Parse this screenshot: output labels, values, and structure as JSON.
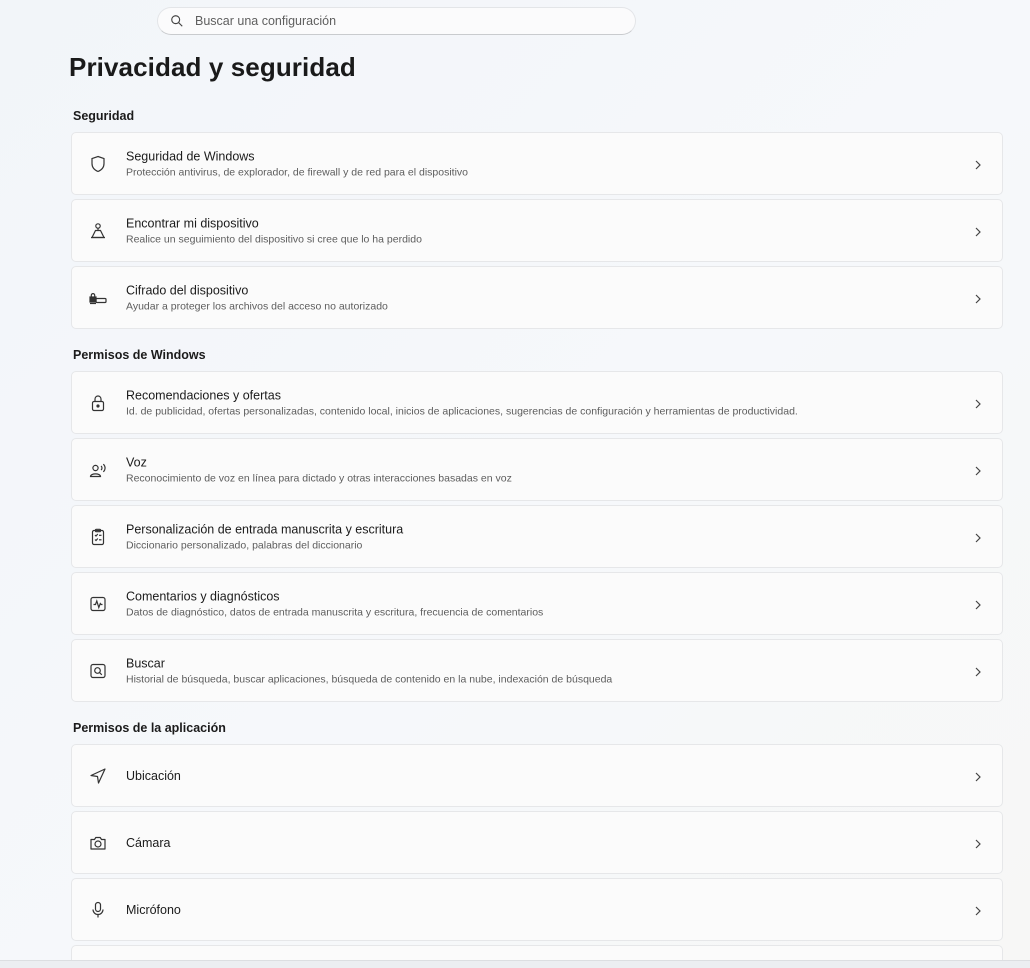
{
  "search": {
    "placeholder": "Buscar una configuración"
  },
  "page": {
    "title": "Privacidad y seguridad"
  },
  "sections": {
    "seguridad": "Seguridad",
    "permisos_windows": "Permisos de Windows",
    "permisos_app": "Permisos de la aplicación"
  },
  "items": [
    {
      "icon": "shield-icon",
      "title": "Seguridad de Windows",
      "desc": "Protección antivirus, de explorador, de firewall y de red para el dispositivo"
    },
    {
      "icon": "find-device-icon",
      "title": "Encontrar mi dispositivo",
      "desc": "Realice un seguimiento del dispositivo si cree que lo ha perdido"
    },
    {
      "icon": "device-encryption-icon",
      "title": "Cifrado del dispositivo",
      "desc": "Ayudar a proteger los archivos del acceso no autorizado"
    },
    {
      "icon": "lock-icon",
      "title": "Recomendaciones y ofertas",
      "desc": "Id. de publicidad, ofertas personalizadas, contenido local, inicios de aplicaciones, sugerencias de configuración y herramientas de productividad."
    },
    {
      "icon": "speech-icon",
      "title": "Voz",
      "desc": "Reconocimiento de voz en línea para dictado y otras interacciones basadas en voz"
    },
    {
      "icon": "clipboard-icon",
      "title": "Personalización de entrada manuscrita y escritura",
      "desc": "Diccionario personalizado, palabras del diccionario"
    },
    {
      "icon": "diagnostics-icon",
      "title": "Comentarios y diagnósticos",
      "desc": "Datos de diagnóstico, datos de entrada manuscrita y escritura, frecuencia de comentarios"
    },
    {
      "icon": "search-box-icon",
      "title": "Buscar",
      "desc": "Historial de búsqueda, buscar aplicaciones, búsqueda de contenido en la nube, indexación de búsqueda"
    },
    {
      "icon": "location-icon",
      "title": "Ubicación"
    },
    {
      "icon": "camera-icon",
      "title": "Cámara"
    },
    {
      "icon": "microphone-icon",
      "title": "Micrófono"
    }
  ]
}
